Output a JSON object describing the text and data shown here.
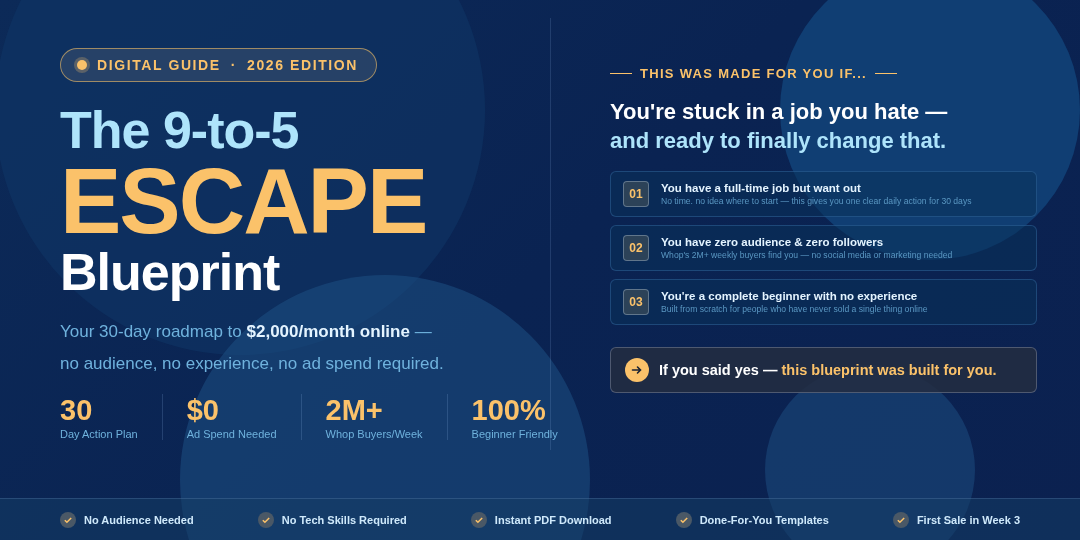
{
  "badge": {
    "parts": [
      "DIGITAL GUIDE",
      "·",
      "2026 EDITION"
    ]
  },
  "title": {
    "line_1": "The 9-to-5",
    "line_2": "ESCAPE",
    "line_3": "Blueprint"
  },
  "subtitle": "Your 30-day roadmap to **$2,000/month online** —\nno audience, no experience, no ad spend required.",
  "stats": [
    {
      "value": "30",
      "label": "Day Action Plan"
    },
    {
      "value": "$0",
      "label": "Ad Spend Needed"
    },
    {
      "value": "2M+",
      "label": "Whop Buyers/Week"
    },
    {
      "value": "100%",
      "label": "Beginner Friendly"
    }
  ],
  "audience": {
    "eyebrow": "THIS WAS MADE FOR YOU IF...",
    "headline_1": "You're stuck in a job you hate —",
    "headline_2": "and ready to finally change that.",
    "items": [
      {
        "number": "01",
        "title": "You have a full-time job but want out",
        "detail": "No time. no idea where to start — this gives you one clear daily action for 30 days"
      },
      {
        "number": "02",
        "title": "You have zero audience & zero followers",
        "detail": "Whop's 2M+ weekly buyers find you — no social media or marketing needed"
      },
      {
        "number": "03",
        "title": "You're a complete beginner with no experience",
        "detail": "Built from scratch for people who have never sold a single thing online"
      }
    ],
    "callout": {
      "lead": "If you said yes —",
      "highlight": "this blueprint was built for you."
    }
  },
  "features": [
    "No Audience Needed",
    "No Tech Skills Required",
    "Instant PDF Download",
    "Done-For-You Templates",
    "First Sale in Week 3"
  ]
}
